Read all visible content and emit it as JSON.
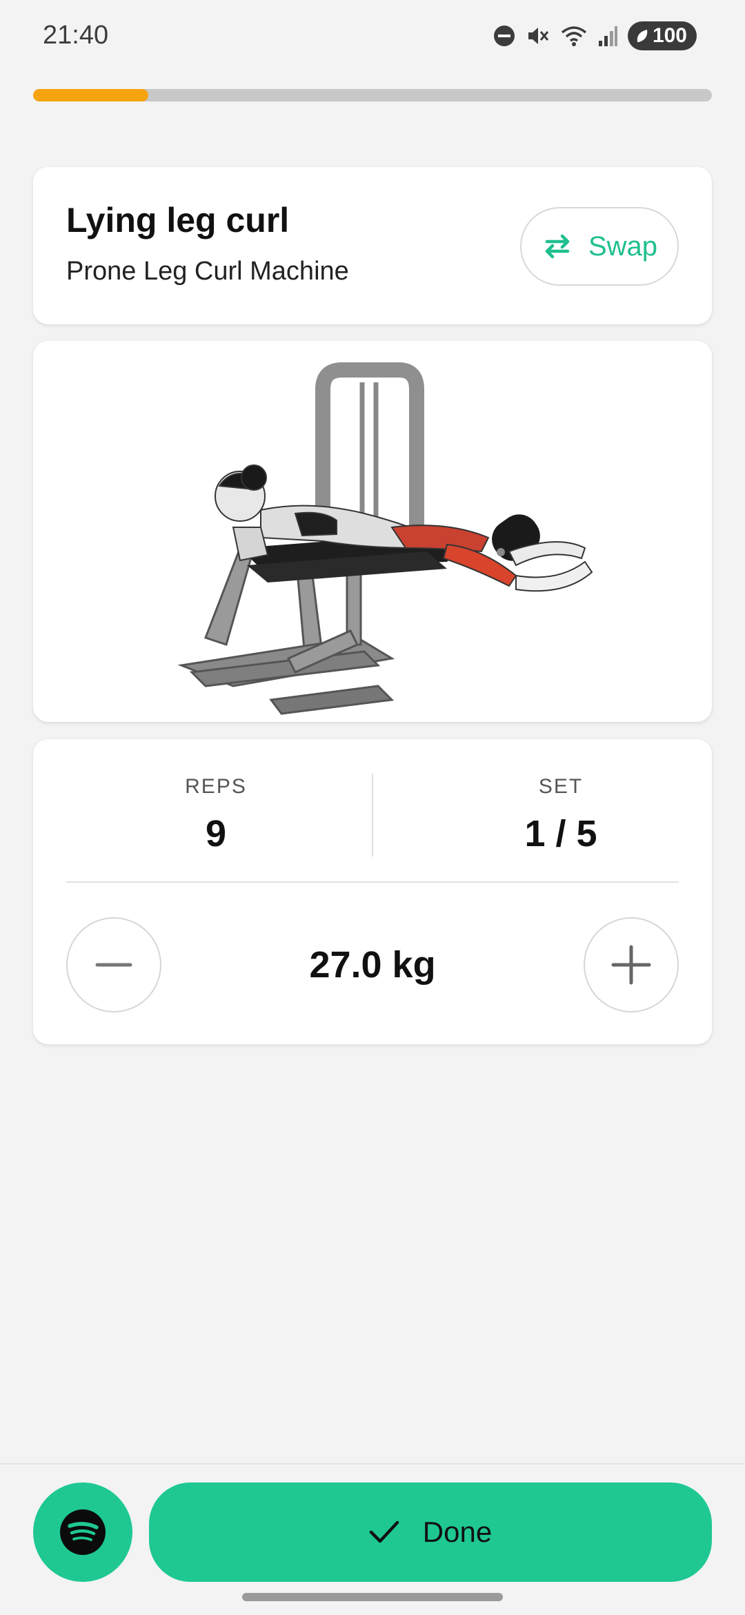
{
  "status_bar": {
    "time": "21:40",
    "battery": "100",
    "icons": [
      "do-not-disturb-icon",
      "mute-icon",
      "wifi-icon",
      "signal-icon",
      "battery-icon"
    ]
  },
  "progress": {
    "fraction": 0.17,
    "color": "#f5a30f"
  },
  "exercise": {
    "title": "Lying leg curl",
    "equipment": "Prone Leg Curl Machine",
    "swap_label": "Swap"
  },
  "stats": {
    "reps_label": "REPS",
    "reps_value": "9",
    "set_label": "SET",
    "set_value": "1 / 5",
    "weight": "27.0 kg"
  },
  "actions": {
    "done_label": "Done"
  },
  "colors": {
    "accent": "#1fc893",
    "swap_text": "#1fbf8f",
    "progress": "#f5a30f",
    "muscle_highlight": "#d9442c"
  }
}
